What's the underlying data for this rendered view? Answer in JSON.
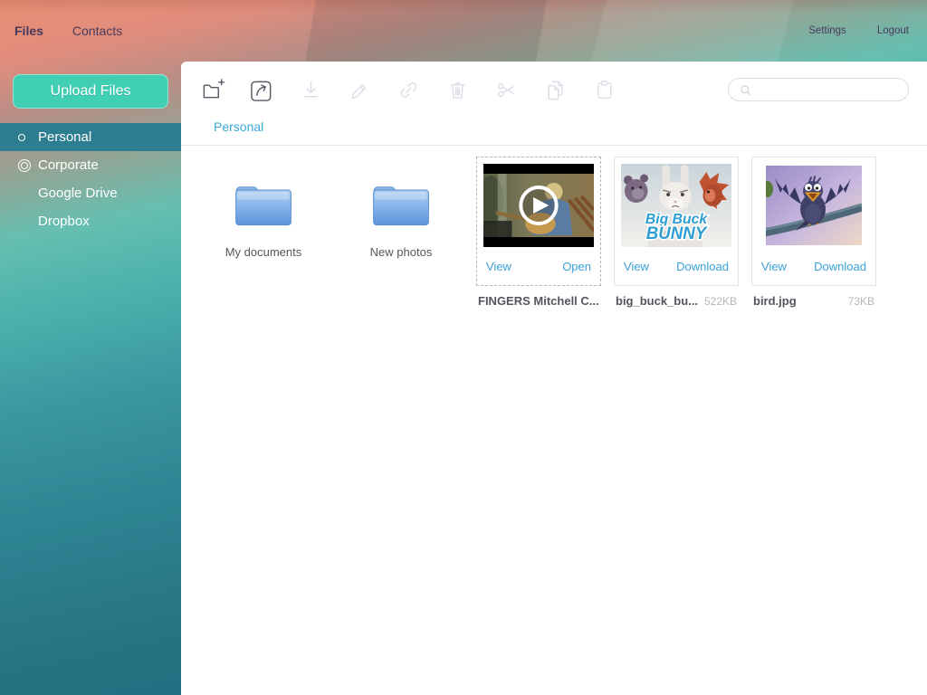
{
  "topbar": {
    "nav": [
      {
        "label": "Files",
        "active": true
      },
      {
        "label": "Contacts",
        "active": false
      }
    ],
    "actions": [
      {
        "label": "Settings"
      },
      {
        "label": "Logout"
      }
    ]
  },
  "sidebar": {
    "upload_button": "Upload Files",
    "items": [
      {
        "label": "Personal",
        "icon": "circle",
        "selected": true
      },
      {
        "label": "Corporate",
        "icon": "double-circle",
        "selected": false
      },
      {
        "label": "Google Drive",
        "icon": "none",
        "selected": false
      },
      {
        "label": "Dropbox",
        "icon": "none",
        "selected": false
      }
    ]
  },
  "toolbar": {
    "buttons": [
      {
        "name": "new-folder",
        "enabled": true
      },
      {
        "name": "open",
        "enabled": true
      },
      {
        "name": "download",
        "enabled": false
      },
      {
        "name": "rename",
        "enabled": false
      },
      {
        "name": "link",
        "enabled": false
      },
      {
        "name": "delete",
        "enabled": false
      },
      {
        "name": "cut",
        "enabled": false
      },
      {
        "name": "copy",
        "enabled": false
      },
      {
        "name": "paste",
        "enabled": false
      }
    ],
    "search": {
      "value": "",
      "placeholder": ""
    }
  },
  "breadcrumb": {
    "current": "Personal"
  },
  "content": {
    "folders": [
      {
        "name": "My documents"
      },
      {
        "name": "New photos"
      }
    ],
    "files": [
      {
        "name": "FINGERS Mitchell C...",
        "size": "",
        "type": "video",
        "selected": true,
        "actions": [
          "View",
          "Open"
        ]
      },
      {
        "name": "big_buck_bu...",
        "size": "522KB",
        "type": "image",
        "selected": false,
        "actions": [
          "View",
          "Download"
        ],
        "poster_text": {
          "line1": "Big Buck",
          "line2": "BUNNY"
        }
      },
      {
        "name": "bird.jpg",
        "size": "73KB",
        "type": "image",
        "selected": false,
        "actions": [
          "View",
          "Download"
        ]
      }
    ]
  },
  "colors": {
    "upload_button": "#41cfb4",
    "selected_nav": "#2d7e91",
    "link_blue": "#3aa2dc",
    "topbar_text": "#473a5c",
    "file_name_text": "#54565e",
    "file_size_text": "#b3b7bb",
    "toolbar_icon_enabled": "#575b66",
    "toolbar_icon_disabled": "#dcdee8"
  }
}
